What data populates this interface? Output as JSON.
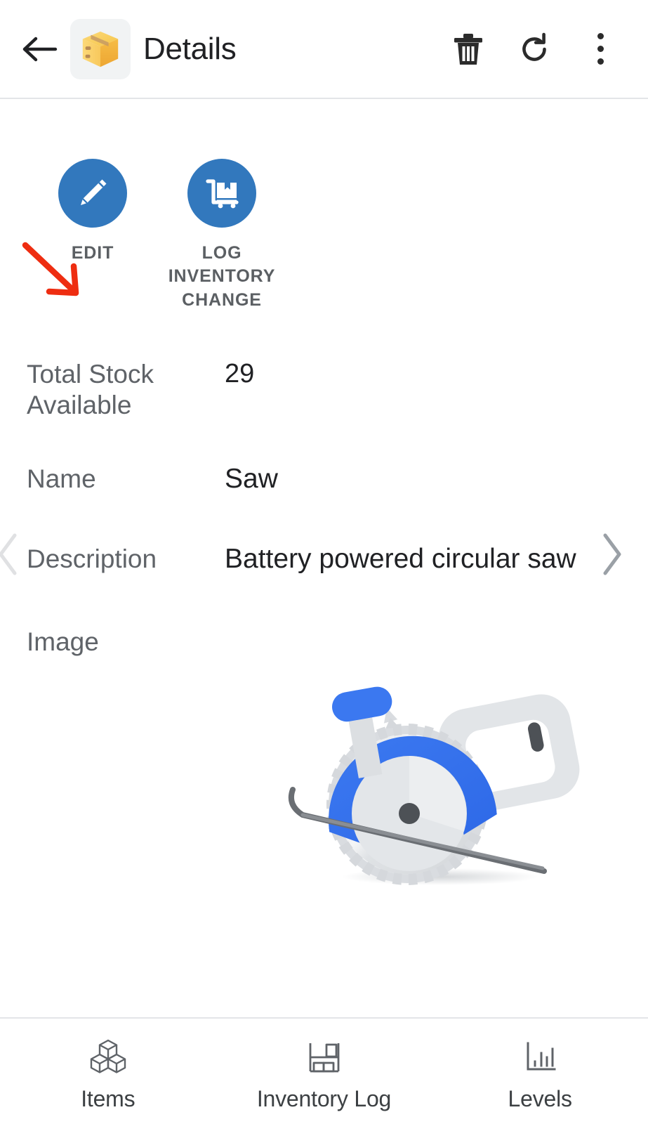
{
  "appbar": {
    "back_icon": "arrow-left-icon",
    "app_emoji": "package-emoji",
    "title": "Details",
    "actions": [
      {
        "name": "delete-button",
        "icon": "trash-icon"
      },
      {
        "name": "refresh-button",
        "icon": "refresh-icon"
      },
      {
        "name": "overflow-menu-button",
        "icon": "more-vertical-icon"
      }
    ]
  },
  "quick_actions": [
    {
      "label": "EDIT",
      "icon": "pencil-icon"
    },
    {
      "label": "LOG INVENTORY CHANGE",
      "icon": "hand-truck-box-icon"
    }
  ],
  "annotation": {
    "type": "arrow",
    "color": "#ee2d11",
    "points_to": "EDIT"
  },
  "fields": [
    {
      "label": "Total Stock Available",
      "value": "29"
    },
    {
      "label": "Name",
      "value": "Saw"
    },
    {
      "label": "Description",
      "value": "Battery powered circular saw"
    },
    {
      "label": "Image",
      "value": ""
    }
  ],
  "record_nav": {
    "prev_icon": "chevron-left-icon",
    "next_icon": "chevron-right-icon"
  },
  "product_image": {
    "alt": "circular-saw-illustration"
  },
  "bottom_nav": [
    {
      "label": "Items",
      "icon": "cubes-icon"
    },
    {
      "label": "Inventory Log",
      "icon": "shelf-boxes-icon"
    },
    {
      "label": "Levels",
      "icon": "bar-chart-icon"
    }
  ],
  "colors": {
    "accent_blue": "#3278bd",
    "saw_blue": "#3b78f0",
    "annotation_red": "#ee2d11",
    "label_gray": "#5f6368",
    "text_dark": "#202124",
    "divider": "#e3e5e8"
  }
}
